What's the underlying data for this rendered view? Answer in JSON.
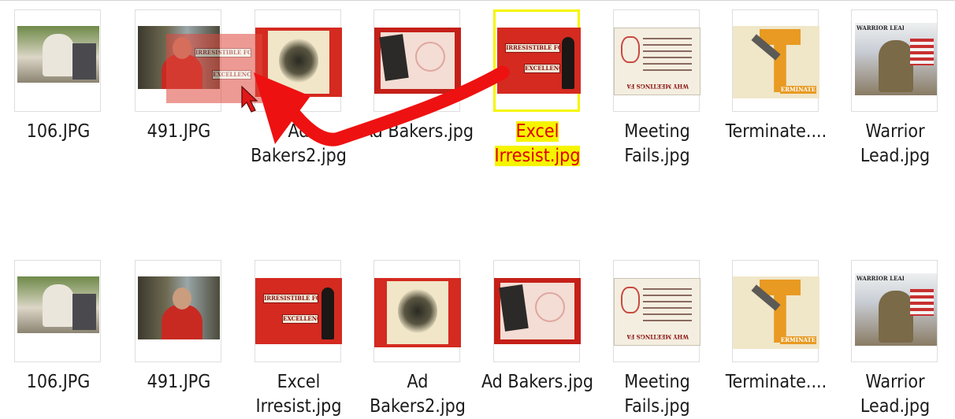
{
  "row_top": [
    {
      "label": "106.JPG",
      "image": "photo-group-outdoor",
      "selected": false
    },
    {
      "label": "491.JPG",
      "image": "photo-man-red-shirt",
      "selected": false
    },
    {
      "label": "Ad Bakers2.jpg",
      "image": "poster-vintage-emblem",
      "selected": false
    },
    {
      "label": "Ad Bakers.jpg",
      "image": "poster-red-product",
      "selected": false
    },
    {
      "label": "Excel Irresist.jpg",
      "image": "poster-irresistible-force",
      "selected": true
    },
    {
      "label": "Meeting Fails.jpg",
      "image": "poster-meeting-fails",
      "selected": false
    },
    {
      "label": "Terminate....",
      "image": "poster-terminate",
      "selected": false
    },
    {
      "label": "Warrior Lead.jpg",
      "image": "poster-warrior-leadership",
      "selected": false
    }
  ],
  "row_bottom": [
    {
      "label": "106.JPG",
      "image": "photo-group-outdoor"
    },
    {
      "label": "491.JPG",
      "image": "photo-man-red-shirt"
    },
    {
      "label": "Excel Irresist.jpg",
      "image": "poster-irresistible-force"
    },
    {
      "label": "Ad Bakers2.jpg",
      "image": "poster-vintage-emblem"
    },
    {
      "label": "Ad Bakers.jpg",
      "image": "poster-red-product"
    },
    {
      "label": "Meeting Fails.jpg",
      "image": "poster-meeting-fails"
    },
    {
      "label": "Terminate....",
      "image": "poster-terminate"
    },
    {
      "label": "Warrior Lead.jpg",
      "image": "poster-warrior-leadership"
    }
  ],
  "poster_text": {
    "irresistible_1": "IRRESISTIBLE FORCE",
    "irresistible_2": "EXCELLENCE",
    "meeting": "WHY MEETINGS FAIL",
    "terminate": "ERMINATE",
    "warrior": "WARRIOR LEADERSHIP"
  },
  "drag_ghost": {
    "image": "poster-irresistible-force",
    "text_1": "IRRESISTIBLE FORCE",
    "text_2": "EXCELLENCE"
  },
  "annotation": {
    "type": "drag-arrow",
    "color": "#ee1111"
  },
  "colors": {
    "selection": "#f5f500",
    "selected_text": "#e00000",
    "poster_red": "#d42a20"
  }
}
